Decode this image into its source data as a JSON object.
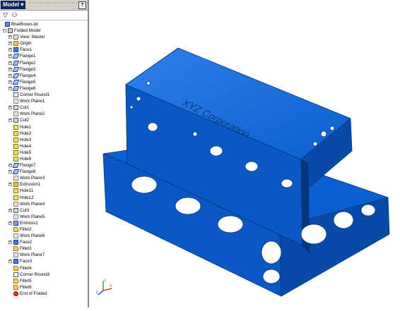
{
  "browser": {
    "dropdown_label": "Model ▾",
    "help_label": "?",
    "toolbar": [
      {
        "icon": "filter-icon",
        "glyph": "▽"
      },
      {
        "icon": "find-icon",
        "glyph": "⚇"
      }
    ]
  },
  "tree": [
    {
      "label": "BlueBoxes.ipt",
      "icon": "part",
      "level": 0,
      "expander": ""
    },
    {
      "label": "Folded Model",
      "icon": "assembly",
      "level": 1,
      "expander": "-"
    },
    {
      "label": "View: Master",
      "icon": "view",
      "level": 2,
      "expander": "+"
    },
    {
      "label": "Origin",
      "icon": "folder",
      "level": 2,
      "expander": "+"
    },
    {
      "label": "Face1",
      "icon": "face",
      "level": 2,
      "expander": "+"
    },
    {
      "label": "Flange1",
      "icon": "flange",
      "level": 2,
      "expander": "+"
    },
    {
      "label": "Flange2",
      "icon": "flange",
      "level": 2,
      "expander": "+"
    },
    {
      "label": "Flange3",
      "icon": "flange",
      "level": 2,
      "expander": "+"
    },
    {
      "label": "Flange4",
      "icon": "flange",
      "level": 2,
      "expander": "+"
    },
    {
      "label": "Flange5",
      "icon": "flange",
      "level": 2,
      "expander": "+"
    },
    {
      "label": "Flange6",
      "icon": "flange",
      "level": 2,
      "expander": "+"
    },
    {
      "label": "Corner Round1",
      "icon": "corner",
      "level": 2,
      "expander": ""
    },
    {
      "label": "Work Plane1",
      "icon": "workplane",
      "level": 2,
      "expander": ""
    },
    {
      "label": "Cut1",
      "icon": "cut",
      "level": 2,
      "expander": "+"
    },
    {
      "label": "Work Plane2",
      "icon": "workplane",
      "level": 2,
      "expander": ""
    },
    {
      "label": "Cut2",
      "icon": "cut",
      "level": 2,
      "expander": "+"
    },
    {
      "label": "Hole1",
      "icon": "hole",
      "level": 2,
      "expander": ""
    },
    {
      "label": "Hole2",
      "icon": "hole",
      "level": 2,
      "expander": ""
    },
    {
      "label": "Hole3",
      "icon": "hole",
      "level": 2,
      "expander": ""
    },
    {
      "label": "Hole4",
      "icon": "hole",
      "level": 2,
      "expander": ""
    },
    {
      "label": "Hole5",
      "icon": "hole",
      "level": 2,
      "expander": ""
    },
    {
      "label": "Hole6",
      "icon": "hole",
      "level": 2,
      "expander": ""
    },
    {
      "label": "Flange7",
      "icon": "flange",
      "level": 2,
      "expander": "+"
    },
    {
      "label": "Flange8",
      "icon": "flange",
      "level": 2,
      "expander": "+"
    },
    {
      "label": "Work Plane3",
      "icon": "workplane",
      "level": 2,
      "expander": ""
    },
    {
      "label": "Extrusion1",
      "icon": "extrusion",
      "level": 2,
      "expander": "+"
    },
    {
      "label": "Hole11",
      "icon": "hole",
      "level": 2,
      "expander": ""
    },
    {
      "label": "Hole12",
      "icon": "hole",
      "level": 2,
      "expander": ""
    },
    {
      "label": "Work Plane4",
      "icon": "workplane",
      "level": 2,
      "expander": ""
    },
    {
      "label": "Cut3",
      "icon": "cut",
      "level": 2,
      "expander": "+"
    },
    {
      "label": "Work Plane5",
      "icon": "workplane",
      "level": 2,
      "expander": ""
    },
    {
      "label": "Emboss1",
      "icon": "emboss",
      "level": 2,
      "expander": "+"
    },
    {
      "label": "Fillet2",
      "icon": "fillet",
      "level": 2,
      "expander": ""
    },
    {
      "label": "Work Plane6",
      "icon": "workplane",
      "level": 2,
      "expander": ""
    },
    {
      "label": "Face2",
      "icon": "face",
      "level": 2,
      "expander": "+"
    },
    {
      "label": "Fillet3",
      "icon": "fillet",
      "level": 2,
      "expander": ""
    },
    {
      "label": "Work Plane7",
      "icon": "workplane",
      "level": 2,
      "expander": ""
    },
    {
      "label": "Face3",
      "icon": "face",
      "level": 2,
      "expander": "+"
    },
    {
      "label": "Fillet4",
      "icon": "fillet",
      "level": 2,
      "expander": ""
    },
    {
      "label": "Corner Round3",
      "icon": "corner",
      "level": 2,
      "expander": ""
    },
    {
      "label": "Fillet5",
      "icon": "fillet",
      "level": 2,
      "expander": ""
    },
    {
      "label": "Fillet6",
      "icon": "fillet",
      "level": 2,
      "expander": ""
    },
    {
      "label": "End of Folded",
      "icon": "end",
      "level": 2,
      "expander": ""
    }
  ],
  "model": {
    "engraved_text": "XYZ Corporation",
    "color": "#0b5fd0",
    "shade": "#084aa8",
    "edge": "#06357a"
  },
  "triad": {
    "x": "X",
    "y": "Y",
    "z": "Z"
  }
}
